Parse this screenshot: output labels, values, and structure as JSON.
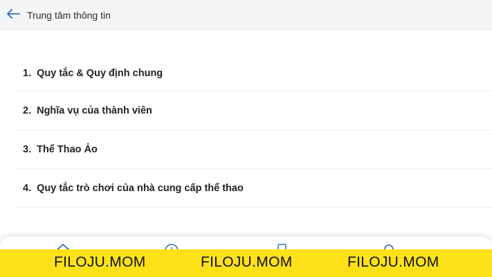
{
  "header": {
    "back_icon": "arrow-left-icon",
    "title": "Trung tâm thông tin"
  },
  "list": {
    "items": [
      {
        "num": "1.",
        "label": "Quy tắc & Quy định chung"
      },
      {
        "num": "2.",
        "label": "Nghĩa vụ của thành viên"
      },
      {
        "num": "3.",
        "label": "Thể Thao Ảo"
      },
      {
        "num": "4.",
        "label": "Quy tắc trò chơi của nhà cung cấp thể thao"
      }
    ]
  },
  "bottom_nav": {
    "icons": [
      "home-icon",
      "deposit-icon",
      "document-icon",
      "user-icon"
    ]
  },
  "watermark": {
    "texts": [
      "FILOJU.MOM",
      "FILOJU.MOM",
      "FILOJU.MOM"
    ],
    "color": "#fde21a"
  },
  "colors": {
    "accent": "#2d6fb7",
    "header_bg": "#f4f5f7"
  }
}
